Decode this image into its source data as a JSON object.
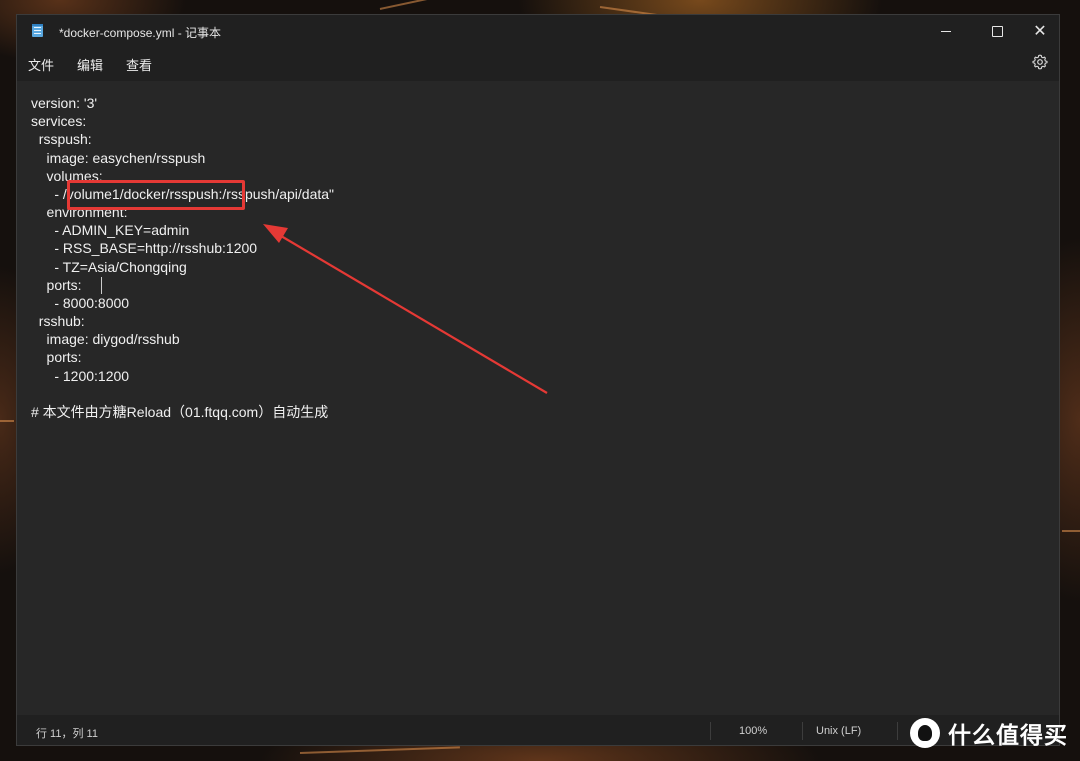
{
  "window": {
    "title": "*docker-compose.yml - 记事本"
  },
  "menu": {
    "file": "文件",
    "edit": "编辑",
    "view": "查看"
  },
  "editor": {
    "lines": [
      "version: '3'",
      "services:",
      "  rsspush:",
      "    image: easychen/rsspush",
      "    volumes:",
      "      - /volume1/docker/rsspush:/rsspush/api/data\"",
      "    environment:",
      "      - ADMIN_KEY=admin",
      "      - RSS_BASE=http://rsshub:1200",
      "      - TZ=Asia/Chongqing",
      "    ports:",
      "      - 8000:8000",
      "  rsshub:",
      "    image: diygod/rsshub",
      "    ports:",
      "      - 1200:1200",
      "",
      "# 本文件由方糖Reload（01.ftqq.com）自动生成"
    ]
  },
  "status": {
    "position": "行 11，列 11",
    "zoom": "100%",
    "line_ending": "Unix (LF)"
  },
  "annotation": {
    "color": "#e53935"
  },
  "watermark": {
    "text": "什么值得买"
  },
  "icons": {
    "app": "notepad-icon",
    "settings": "gear-icon",
    "minimize": "minimize-icon",
    "maximize": "maximize-icon",
    "close": "close-icon"
  }
}
